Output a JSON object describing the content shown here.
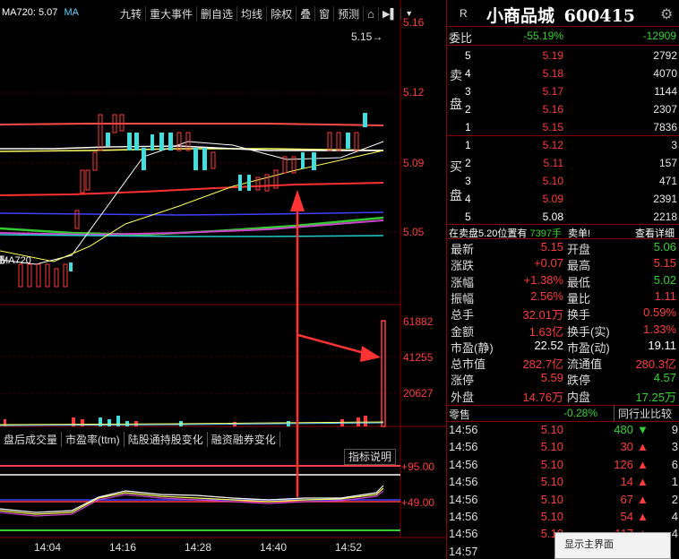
{
  "chart_panel": {
    "ma_label": "MA720: 5.07",
    "ma_label_short": "MA",
    "toolbar": [
      "九转",
      "重大事件",
      "删自选",
      "均线",
      "除权",
      "叠",
      "窗",
      "预测"
    ],
    "current_price_marker": "5.15→",
    "price_axis": [
      "5.16",
      "5.12",
      "5.09",
      "5.05"
    ],
    "ma_low_label": "MA720",
    "volume_axis": [
      "61882",
      "41255",
      "20627"
    ],
    "tabs": [
      "盘后成交量",
      "市盈率(ttm)",
      "陆股通持股变化",
      "融资融券变化"
    ],
    "indicator_btn": "指标说明",
    "indicator_axis": [
      "+95.00",
      "+49.00"
    ],
    "time_axis": [
      "14:04",
      "14:16",
      "14:28",
      "14:40",
      "14:52"
    ]
  },
  "stock": {
    "r_badge": "R",
    "name": "小商品城",
    "code": "600415"
  },
  "weibi": {
    "label": "委比",
    "ratio": "-55.19%",
    "diff": "-12909"
  },
  "sell_label": [
    "卖",
    "盘"
  ],
  "sell": [
    {
      "lv": "5",
      "price": "5.19",
      "vol": "2792"
    },
    {
      "lv": "4",
      "price": "5.18",
      "vol": "4070"
    },
    {
      "lv": "3",
      "price": "5.17",
      "vol": "1144"
    },
    {
      "lv": "2",
      "price": "5.16",
      "vol": "2307"
    },
    {
      "lv": "1",
      "price": "5.15",
      "vol": "7836"
    }
  ],
  "buy_label": [
    "买",
    "盘"
  ],
  "buy": [
    {
      "lv": "1",
      "price": "5.12",
      "vol": "3"
    },
    {
      "lv": "2",
      "price": "5.11",
      "vol": "157"
    },
    {
      "lv": "3",
      "price": "5.10",
      "vol": "471"
    },
    {
      "lv": "4",
      "price": "5.09",
      "vol": "2391"
    },
    {
      "lv": "5",
      "price": "5.08",
      "vol": "2218"
    }
  ],
  "position_info": {
    "text": "在卖盘5.20位置有",
    "vol": "7397手",
    "side": "卖单!",
    "link": "查看详细"
  },
  "quotes": [
    {
      "k": "最新",
      "v": "5.15",
      "vc": "red",
      "k2": "开盘",
      "v2": "5.06",
      "v2c": "green"
    },
    {
      "k": "涨跌",
      "v": "+0.07",
      "vc": "red",
      "k2": "最高",
      "v2": "5.15",
      "v2c": "red"
    },
    {
      "k": "涨幅",
      "v": "+1.38%",
      "vc": "red",
      "k2": "最低",
      "v2": "5.02",
      "v2c": "green"
    },
    {
      "k": "振幅",
      "v": "2.56%",
      "vc": "red",
      "k2": "量比",
      "v2": "1.11",
      "v2c": "red"
    },
    {
      "k": "总手",
      "v": "32.01万",
      "vc": "red",
      "k2": "换手",
      "v2": "0.59%",
      "v2c": "red"
    },
    {
      "k": "金额",
      "v": "1.63亿",
      "vc": "red",
      "k2": "换手(实)",
      "v2": "1.33%",
      "v2c": "red"
    },
    {
      "k": "市盈(静)",
      "v": "22.52",
      "vc": "white",
      "k2": "市盈(动)",
      "v2": "19.11",
      "v2c": "white"
    },
    {
      "k": "总市值",
      "v": "282.7亿",
      "vc": "red",
      "k2": "流通值",
      "v2": "280.3亿",
      "v2c": "red"
    },
    {
      "k": "涨停",
      "v": "5.59",
      "vc": "red",
      "k2": "跌停",
      "v2": "4.57",
      "v2c": "green"
    },
    {
      "k": "外盘",
      "v": "14.76万",
      "vc": "red",
      "k2": "内盘",
      "v2": "17.25万",
      "v2c": "green"
    }
  ],
  "sector": {
    "k": "零售",
    "v": "-0.28%",
    "link": "同行业比较"
  },
  "ticks": [
    {
      "t": "14:56",
      "p": "5.10",
      "q": "480",
      "dir": "down",
      "n": "9"
    },
    {
      "t": "14:56",
      "p": "5.10",
      "q": "30",
      "dir": "up",
      "n": "3"
    },
    {
      "t": "14:56",
      "p": "5.10",
      "q": "126",
      "dir": "up",
      "n": "6"
    },
    {
      "t": "14:56",
      "p": "5.10",
      "q": "14",
      "dir": "up",
      "n": "1"
    },
    {
      "t": "14:56",
      "p": "5.10",
      "q": "67",
      "dir": "up",
      "n": "2"
    },
    {
      "t": "14:56",
      "p": "5.10",
      "q": "54",
      "dir": "up",
      "n": "4"
    },
    {
      "t": "14:56",
      "p": "5.10",
      "q": "117",
      "dir": "up",
      "n": "4"
    },
    {
      "t": "14:57",
      "p": "",
      "q": "",
      "dir": "",
      "n": ""
    }
  ],
  "main_view_btn": "显示主界面",
  "colors": {
    "up": "#ff3b3b",
    "down": "#34d134",
    "border": "#8a0000"
  }
}
